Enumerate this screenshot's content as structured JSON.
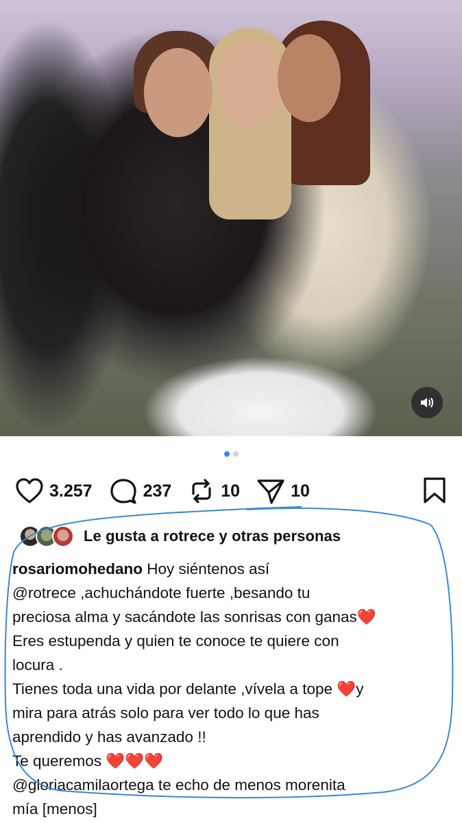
{
  "post": {
    "sound_icon": "speaker-icon",
    "carousel": {
      "total": 2,
      "active": 1
    }
  },
  "actions": {
    "likes": "3.257",
    "comments": "237",
    "reposts": "10",
    "shares": "10"
  },
  "liked_by": {
    "prefix": "Le gusta a ",
    "user": "rotrece",
    "connector": " y ",
    "others": "otras personas"
  },
  "caption": {
    "username": "rosariomohedano",
    "lines": [
      " Hoy siéntenos así",
      "@rotrece ,achuchándote fuerte ,besando tu",
      "preciosa alma y sacándote las sonrisas con ganas❤️",
      "Eres estupenda y quien te conoce te quiere con",
      "locura .",
      "Tienes toda una vida por delante ,vívela a tope ❤️y",
      "mira para atrás solo para ver todo lo que has",
      "aprendido y has avanzado !!",
      "Te queremos ❤️❤️❤️",
      "@gloriacamilaortega te echo de menos morenita",
      "mía [menos]"
    ]
  },
  "colors": {
    "accent": "#3b82f6",
    "highlight_ring": "#3a86d4",
    "heart": "#e91e63"
  }
}
